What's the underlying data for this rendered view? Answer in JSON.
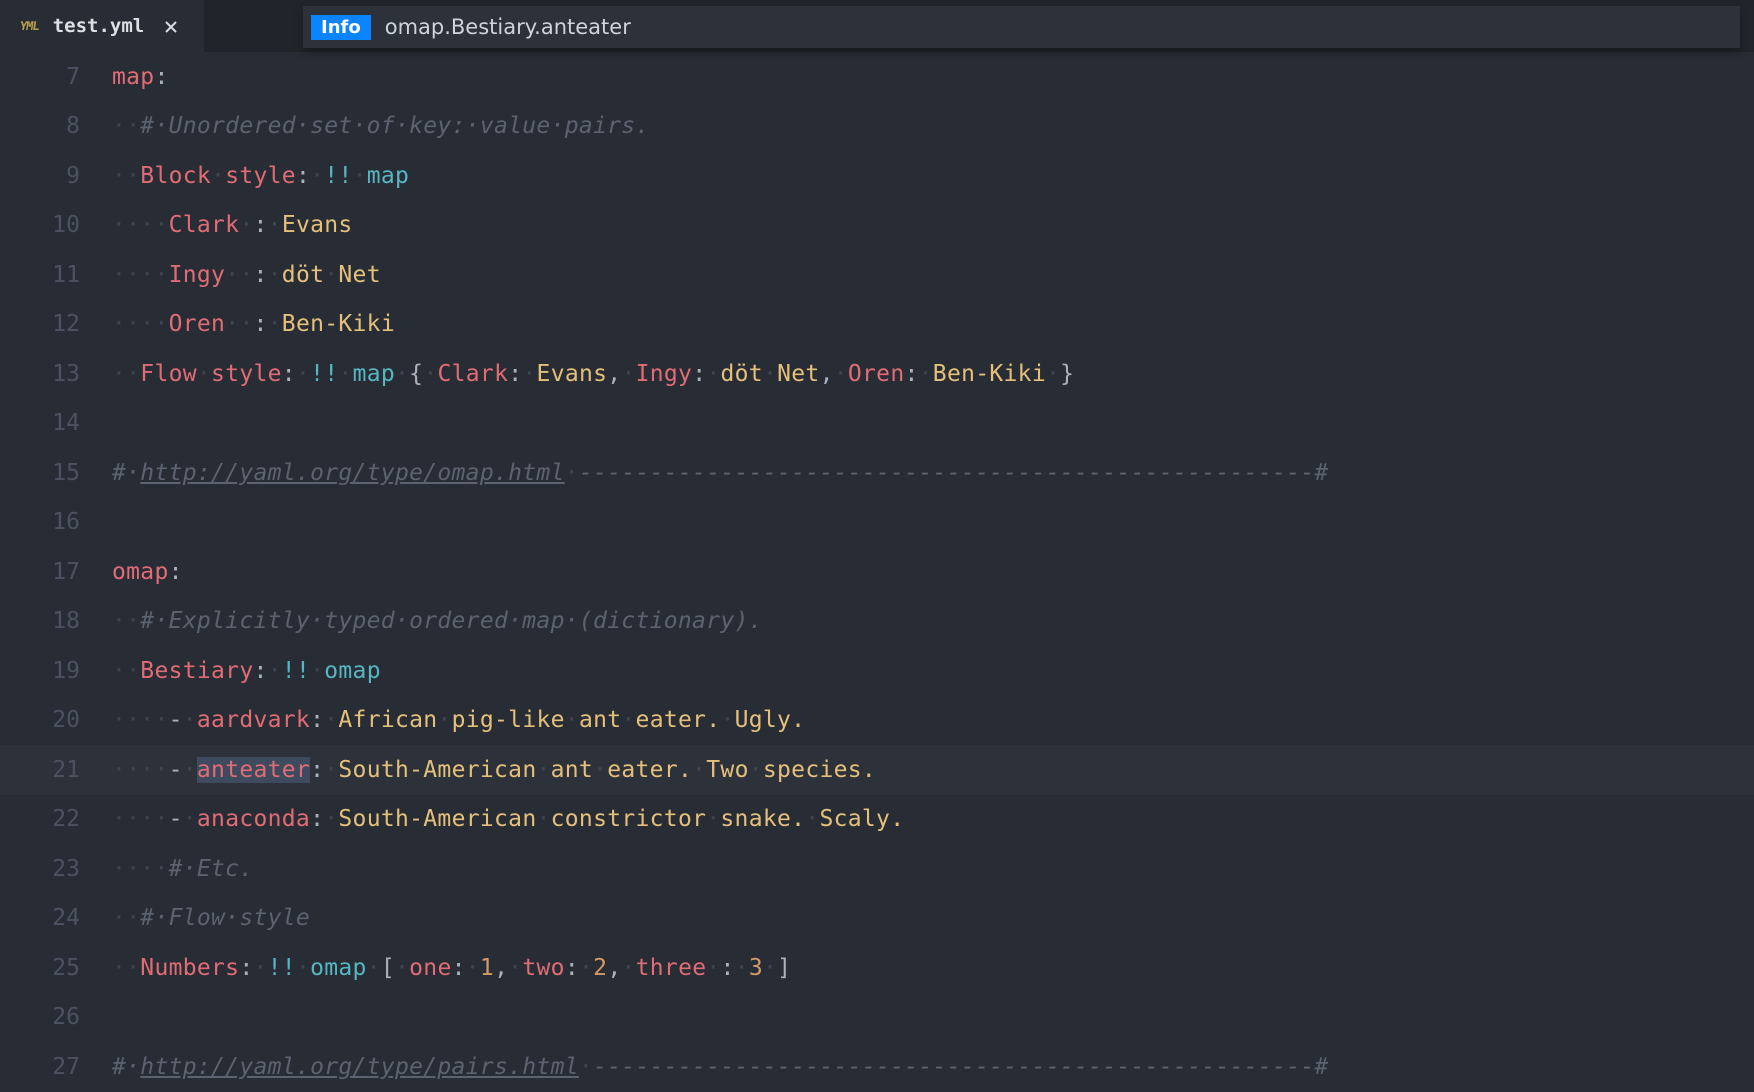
{
  "tab": {
    "badge": "YML",
    "filename": "test.yml",
    "close_glyph": "×"
  },
  "info": {
    "badge": "Info",
    "text": "omap.Bestiary.anteater"
  },
  "gutter_start": 7,
  "highlighted_line_index": 14,
  "lines": [
    [
      {
        "c": "key",
        "t": "map"
      },
      {
        "c": "pun",
        "t": ":"
      }
    ],
    [
      {
        "c": "ws",
        "t": "··"
      },
      {
        "c": "cmt",
        "t": "#·Unordered·set·of·key:·value·pairs."
      }
    ],
    [
      {
        "c": "ws",
        "t": "··"
      },
      {
        "c": "key",
        "t": "Block"
      },
      {
        "c": "ws",
        "t": "·"
      },
      {
        "c": "key",
        "t": "style"
      },
      {
        "c": "pun",
        "t": ":"
      },
      {
        "c": "ws",
        "t": "·"
      },
      {
        "c": "tag",
        "t": "!!"
      },
      {
        "c": "ws",
        "t": "·"
      },
      {
        "c": "tag",
        "t": "map"
      }
    ],
    [
      {
        "c": "ws",
        "t": "····"
      },
      {
        "c": "key",
        "t": "Clark"
      },
      {
        "c": "ws",
        "t": "·"
      },
      {
        "c": "pun",
        "t": ":"
      },
      {
        "c": "ws",
        "t": "·"
      },
      {
        "c": "val",
        "t": "Evans"
      }
    ],
    [
      {
        "c": "ws",
        "t": "····"
      },
      {
        "c": "key",
        "t": "Ingy"
      },
      {
        "c": "ws",
        "t": "··"
      },
      {
        "c": "pun",
        "t": ":"
      },
      {
        "c": "ws",
        "t": "·"
      },
      {
        "c": "val",
        "t": "döt"
      },
      {
        "c": "ws",
        "t": "·"
      },
      {
        "c": "val",
        "t": "Net"
      }
    ],
    [
      {
        "c": "ws",
        "t": "····"
      },
      {
        "c": "key",
        "t": "Oren"
      },
      {
        "c": "ws",
        "t": "··"
      },
      {
        "c": "pun",
        "t": ":"
      },
      {
        "c": "ws",
        "t": "·"
      },
      {
        "c": "val",
        "t": "Ben-Kiki"
      }
    ],
    [
      {
        "c": "ws",
        "t": "··"
      },
      {
        "c": "key",
        "t": "Flow"
      },
      {
        "c": "ws",
        "t": "·"
      },
      {
        "c": "key",
        "t": "style"
      },
      {
        "c": "pun",
        "t": ":"
      },
      {
        "c": "ws",
        "t": "·"
      },
      {
        "c": "tag",
        "t": "!!"
      },
      {
        "c": "ws",
        "t": "·"
      },
      {
        "c": "tag",
        "t": "map"
      },
      {
        "c": "ws",
        "t": "·"
      },
      {
        "c": "pun",
        "t": "{"
      },
      {
        "c": "ws",
        "t": "·"
      },
      {
        "c": "key",
        "t": "Clark"
      },
      {
        "c": "pun",
        "t": ":"
      },
      {
        "c": "ws",
        "t": "·"
      },
      {
        "c": "val",
        "t": "Evans"
      },
      {
        "c": "pun",
        "t": ","
      },
      {
        "c": "ws",
        "t": "·"
      },
      {
        "c": "key",
        "t": "Ingy"
      },
      {
        "c": "pun",
        "t": ":"
      },
      {
        "c": "ws",
        "t": "·"
      },
      {
        "c": "val",
        "t": "döt"
      },
      {
        "c": "ws",
        "t": "·"
      },
      {
        "c": "val",
        "t": "Net"
      },
      {
        "c": "pun",
        "t": ","
      },
      {
        "c": "ws",
        "t": "·"
      },
      {
        "c": "key",
        "t": "Oren"
      },
      {
        "c": "pun",
        "t": ":"
      },
      {
        "c": "ws",
        "t": "·"
      },
      {
        "c": "val",
        "t": "Ben-Kiki"
      },
      {
        "c": "ws",
        "t": "·"
      },
      {
        "c": "pun",
        "t": "}"
      }
    ],
    [],
    [
      {
        "c": "cmt",
        "t": "#·"
      },
      {
        "c": "url",
        "t": "http://yaml.org/type/omap.html"
      },
      {
        "c": "ws",
        "t": "·"
      },
      {
        "c": "cmt",
        "t": "----------------------------------------------------#"
      }
    ],
    [],
    [
      {
        "c": "key",
        "t": "omap"
      },
      {
        "c": "pun",
        "t": ":"
      }
    ],
    [
      {
        "c": "ws",
        "t": "··"
      },
      {
        "c": "cmt",
        "t": "#·Explicitly·typed·ordered·map·(dictionary)."
      }
    ],
    [
      {
        "c": "ws",
        "t": "··"
      },
      {
        "c": "key",
        "t": "Bestiary"
      },
      {
        "c": "pun",
        "t": ":"
      },
      {
        "c": "ws",
        "t": "·"
      },
      {
        "c": "tag",
        "t": "!!"
      },
      {
        "c": "ws",
        "t": "·"
      },
      {
        "c": "tag",
        "t": "omap"
      }
    ],
    [
      {
        "c": "ws",
        "t": "····"
      },
      {
        "c": "pun",
        "t": "-"
      },
      {
        "c": "ws",
        "t": "·"
      },
      {
        "c": "key",
        "t": "aardvark"
      },
      {
        "c": "pun",
        "t": ":"
      },
      {
        "c": "ws",
        "t": "·"
      },
      {
        "c": "val",
        "t": "African"
      },
      {
        "c": "ws",
        "t": "·"
      },
      {
        "c": "val",
        "t": "pig-like"
      },
      {
        "c": "ws",
        "t": "·"
      },
      {
        "c": "val",
        "t": "ant"
      },
      {
        "c": "ws",
        "t": "·"
      },
      {
        "c": "val",
        "t": "eater."
      },
      {
        "c": "ws",
        "t": "·"
      },
      {
        "c": "val",
        "t": "Ugly."
      }
    ],
    [
      {
        "c": "ws",
        "t": "····"
      },
      {
        "c": "pun",
        "t": "-"
      },
      {
        "c": "ws",
        "t": "·"
      },
      {
        "c": "key sel",
        "t": "anteater"
      },
      {
        "c": "pun",
        "t": ":"
      },
      {
        "c": "ws",
        "t": "·"
      },
      {
        "c": "val",
        "t": "South-American"
      },
      {
        "c": "ws",
        "t": "·"
      },
      {
        "c": "val",
        "t": "ant"
      },
      {
        "c": "ws",
        "t": "·"
      },
      {
        "c": "val",
        "t": "eater."
      },
      {
        "c": "ws",
        "t": "·"
      },
      {
        "c": "val",
        "t": "Two"
      },
      {
        "c": "ws",
        "t": "·"
      },
      {
        "c": "val",
        "t": "species."
      }
    ],
    [
      {
        "c": "ws",
        "t": "····"
      },
      {
        "c": "pun",
        "t": "-"
      },
      {
        "c": "ws",
        "t": "·"
      },
      {
        "c": "key",
        "t": "anaconda"
      },
      {
        "c": "pun",
        "t": ":"
      },
      {
        "c": "ws",
        "t": "·"
      },
      {
        "c": "val",
        "t": "South-American"
      },
      {
        "c": "ws",
        "t": "·"
      },
      {
        "c": "val",
        "t": "constrictor"
      },
      {
        "c": "ws",
        "t": "·"
      },
      {
        "c": "val",
        "t": "snake."
      },
      {
        "c": "ws",
        "t": "·"
      },
      {
        "c": "val",
        "t": "Scaly."
      }
    ],
    [
      {
        "c": "ws",
        "t": "····"
      },
      {
        "c": "cmt",
        "t": "#·Etc."
      }
    ],
    [
      {
        "c": "ws",
        "t": "··"
      },
      {
        "c": "cmt",
        "t": "#·Flow·style"
      }
    ],
    [
      {
        "c": "ws",
        "t": "··"
      },
      {
        "c": "key",
        "t": "Numbers"
      },
      {
        "c": "pun",
        "t": ":"
      },
      {
        "c": "ws",
        "t": "·"
      },
      {
        "c": "tag",
        "t": "!!"
      },
      {
        "c": "ws",
        "t": "·"
      },
      {
        "c": "tag",
        "t": "omap"
      },
      {
        "c": "ws",
        "t": "·"
      },
      {
        "c": "pun",
        "t": "["
      },
      {
        "c": "ws",
        "t": "·"
      },
      {
        "c": "key",
        "t": "one"
      },
      {
        "c": "pun",
        "t": ":"
      },
      {
        "c": "ws",
        "t": "·"
      },
      {
        "c": "num",
        "t": "1"
      },
      {
        "c": "pun",
        "t": ","
      },
      {
        "c": "ws",
        "t": "·"
      },
      {
        "c": "key",
        "t": "two"
      },
      {
        "c": "pun",
        "t": ":"
      },
      {
        "c": "ws",
        "t": "·"
      },
      {
        "c": "num",
        "t": "2"
      },
      {
        "c": "pun",
        "t": ","
      },
      {
        "c": "ws",
        "t": "·"
      },
      {
        "c": "key",
        "t": "three"
      },
      {
        "c": "ws",
        "t": "·"
      },
      {
        "c": "pun",
        "t": ":"
      },
      {
        "c": "ws",
        "t": "·"
      },
      {
        "c": "num",
        "t": "3"
      },
      {
        "c": "ws",
        "t": "·"
      },
      {
        "c": "pun",
        "t": "]"
      }
    ],
    [],
    [
      {
        "c": "cmt",
        "t": "#·"
      },
      {
        "c": "url",
        "t": "http://yaml.org/type/pairs.html"
      },
      {
        "c": "ws",
        "t": "·"
      },
      {
        "c": "cmt",
        "t": "---------------------------------------------------#"
      }
    ]
  ]
}
